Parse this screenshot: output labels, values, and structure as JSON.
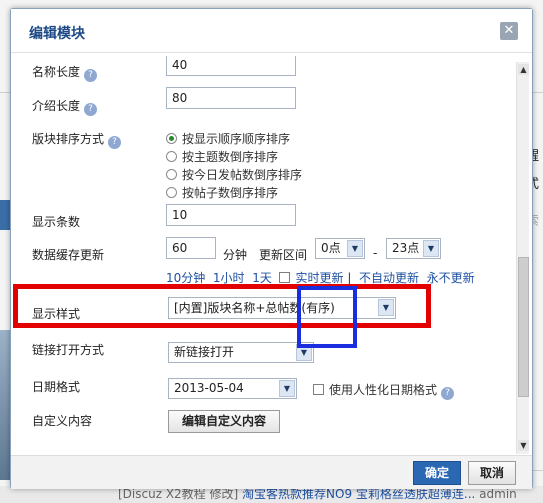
{
  "dialog": {
    "title": "编辑模块",
    "close_icon": "close-icon",
    "ok_label": "确定",
    "cancel_label": "取消"
  },
  "form": {
    "name_length": {
      "label": "名称长度",
      "value": "40"
    },
    "intro_length": {
      "label": "介绍长度",
      "value": "80"
    },
    "sort": {
      "label": "版块排序方式",
      "options": [
        "按显示顺序顺序排序",
        "按主题数倒序排序",
        "按今日发帖数倒序排序",
        "按帖子数倒序排序"
      ],
      "selected_index": 0
    },
    "count": {
      "label": "显示条数",
      "value": "10"
    },
    "cache": {
      "label": "数据缓存更新",
      "minutes": "60",
      "minutes_unit": "分钟",
      "range_label": "更新区间",
      "from": "0点",
      "dash": "-",
      "to": "23点",
      "quick_links": [
        "10分钟",
        "1小时",
        "1天"
      ],
      "realtime": "实时更新",
      "no_auto": "不自动更新",
      "never": "永不更新"
    },
    "display_style": {
      "label": "显示样式",
      "value": "[内置]版块名称+总帖数(有序)"
    },
    "link_open": {
      "label": "链接打开方式",
      "value": "新链接打开"
    },
    "date_format": {
      "label": "日期格式",
      "value": "2013-05-04",
      "humanize": "使用人性化日期格式"
    },
    "custom": {
      "label": "自定义内容",
      "button": "编辑自定义内容"
    }
  },
  "background": {
    "right_chars": [
      "醒",
      "式",
      "索"
    ],
    "bottom_text": "[Discuz X2教程 修改]",
    "bottom_link": "淘宝客热款推荐NO9 宝莉格丝透肤超薄连...",
    "bottom_tail": "admin"
  },
  "highlight_colors": {
    "red": "#e30000",
    "blue": "#1a2ee0"
  },
  "accent": "#2b68b4"
}
